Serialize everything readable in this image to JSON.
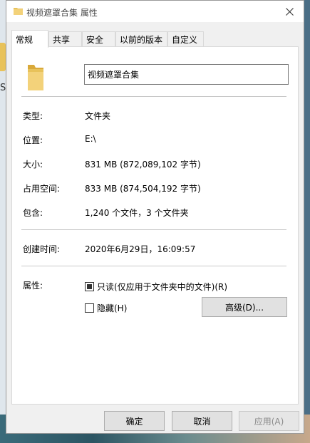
{
  "window": {
    "title": "视频遮罩合集 属性"
  },
  "tabs": [
    {
      "label": "常规",
      "active": true
    },
    {
      "label": "共享",
      "active": false
    },
    {
      "label": "安全",
      "active": false
    },
    {
      "label": "以前的版本",
      "active": false
    },
    {
      "label": "自定义",
      "active": false
    }
  ],
  "general": {
    "name_value": "视频遮罩合集",
    "type": {
      "label": "类型:",
      "value": "文件夹"
    },
    "location": {
      "label": "位置:",
      "value": "E:\\"
    },
    "size": {
      "label": "大小:",
      "value": "831 MB (872,089,102 字节)"
    },
    "size_on_disk": {
      "label": "占用空间:",
      "value": "833 MB (874,504,192 字节)"
    },
    "contains": {
      "label": "包含:",
      "value": "1,240 个文件，3 个文件夹"
    },
    "created": {
      "label": "创建时间:",
      "value": "2020年6月29日，16:09:57"
    },
    "attributes": {
      "label": "属性:",
      "readonly_label": "只读(仅应用于文件夹中的文件)(R)",
      "hidden_label": "隐藏(H)",
      "advanced_label": "高级(D)..."
    }
  },
  "buttons": {
    "ok": "确定",
    "cancel": "取消",
    "apply": "应用(A)"
  },
  "desktop": {
    "partial_label": "S"
  },
  "colors": {
    "folder": "#e8c25a",
    "folder_dark": "#d9a93a"
  }
}
